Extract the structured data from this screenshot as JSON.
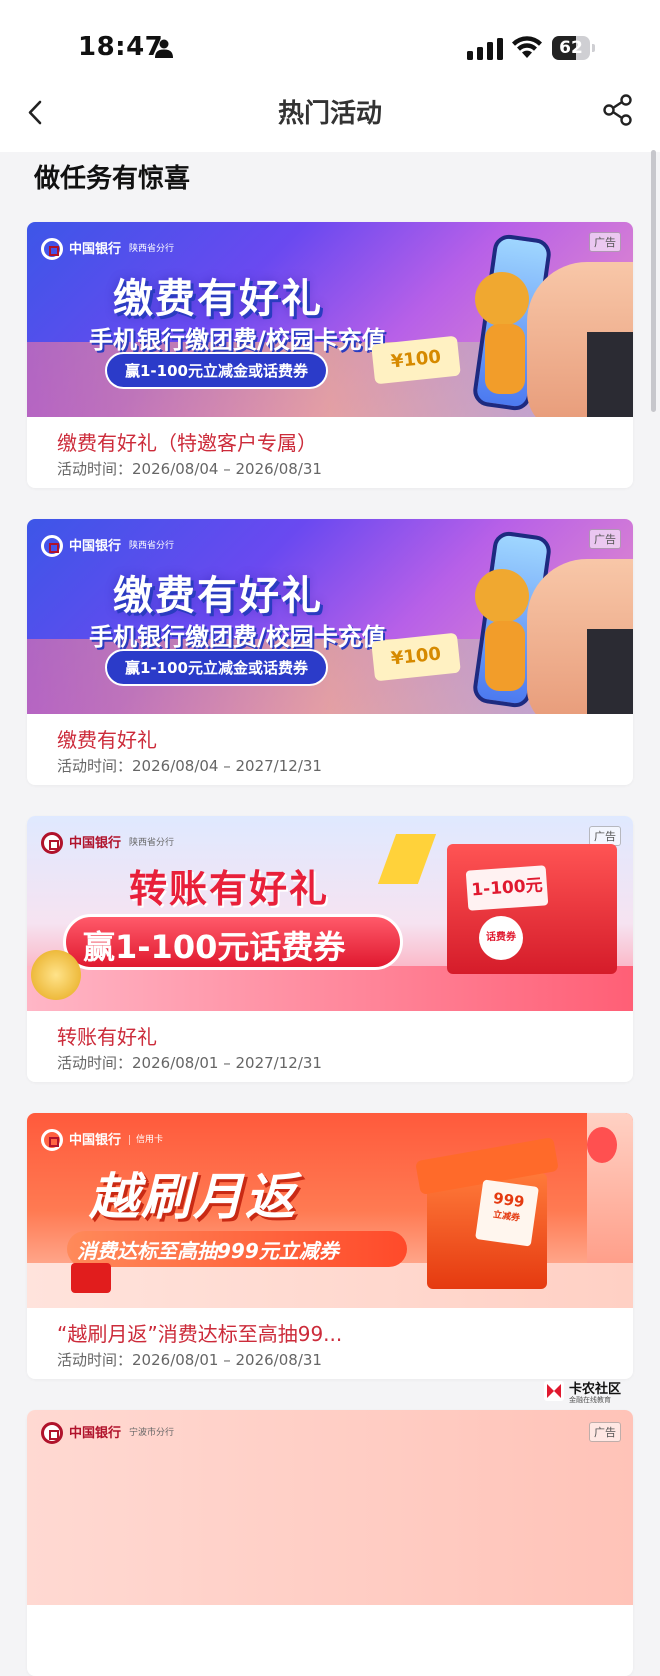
{
  "status_bar": {
    "time": "18:47",
    "battery": "62",
    "battery_level": 0.62
  },
  "nav": {
    "title": "热门活动"
  },
  "section": {
    "title": "做任务有惊喜"
  },
  "activities": [
    {
      "bank": "中国银行",
      "branch": "陕西省分行",
      "ad_label": "广告",
      "banner_headline": "缴费有好礼",
      "banner_subline": "手机银行缴团费/校园卡充值",
      "banner_pill": "赢1-100元立减金或话费券",
      "banner_coupon": "¥100",
      "title": "缴费有好礼（特邀客户专属）",
      "date_label": "活动时间：",
      "date_range": "2026/08/04 – 2026/08/31"
    },
    {
      "bank": "中国银行",
      "branch": "陕西省分行",
      "ad_label": "广告",
      "banner_headline": "缴费有好礼",
      "banner_subline": "手机银行缴团费/校园卡充值",
      "banner_pill": "赢1-100元立减金或话费券",
      "banner_coupon": "¥100",
      "title": "缴费有好礼",
      "date_label": "活动时间：",
      "date_range": "2026/08/04 – 2027/12/31"
    },
    {
      "bank": "中国银行",
      "branch": "陕西省分行",
      "ad_label": "广告",
      "banner_headline": "转账有好礼",
      "banner_subline": "赢1-100元话费券",
      "banner_coupon": "1-100元",
      "banner_coupon_tag": "话费券",
      "title": "转账有好礼",
      "date_label": "活动时间：",
      "date_range": "2026/08/01 – 2027/12/31"
    },
    {
      "bank": "中国银行",
      "branch": "信用卡",
      "ad_label": "广告",
      "banner_headline": "越刷月返",
      "banner_subline": "消费达标至高抽999元立减券",
      "banner_coupon": "999",
      "banner_coupon_tag": "立减券",
      "title": "“越刷月返”消费达标至高抽99...",
      "date_label": "活动时间：",
      "date_range": "2026/08/01 – 2026/08/31"
    },
    {
      "bank": "中国银行",
      "branch": "宁波市分行",
      "ad_label": "广告"
    }
  ],
  "watermark": {
    "name": "卡农社区",
    "slogan": "金融在线教育"
  },
  "colors": {
    "title_red": "#cc2b3a",
    "boc_red": "#b0122b",
    "page_bg": "#f4f4f6"
  }
}
